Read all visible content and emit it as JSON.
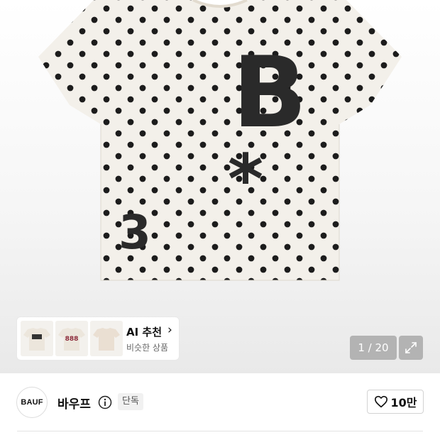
{
  "gallery": {
    "main_image_alt": "polka dot t-shirt",
    "print_graphic": {
      "letter": "B",
      "symbol": "*",
      "number": "3"
    },
    "thumbnails": [
      {
        "name": "thumbnail-1",
        "print": ""
      },
      {
        "name": "thumbnail-2",
        "print": "888"
      },
      {
        "name": "thumbnail-3",
        "print": ""
      }
    ],
    "ai_recommend": {
      "title": "AI 추천",
      "subtitle": "비슷한 상품"
    },
    "page_counter": "1 / 20"
  },
  "brand": {
    "logo_text": "BAUF",
    "name": "바우프",
    "badge": "단독",
    "likes": "10만"
  },
  "colors": {
    "shirt": "#f3f0ea",
    "dots": "#1c1c1c",
    "print": "#2a2a2a",
    "counter_bg": "#a0a0a0"
  }
}
